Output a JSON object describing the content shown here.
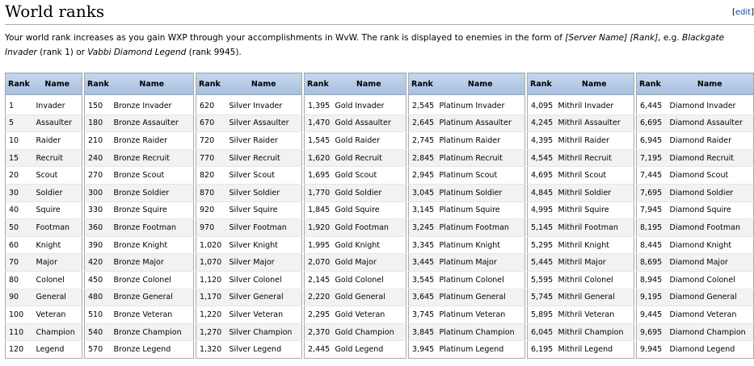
{
  "section": {
    "title": "World ranks",
    "edit_label": "edit"
  },
  "intro": {
    "part1": "Your world rank increases as you gain WXP through your accomplishments in WvW. The rank is displayed to enemies in the form of ",
    "format_italic": "[Server Name] [Rank]",
    "part2": ", e.g. ",
    "example1": "Blackgate Invader",
    "part3": " (rank 1) or ",
    "example2": "Vabbi Diamond Legend",
    "part4": " (rank 9945)."
  },
  "rank_tables": [
    {
      "headers": [
        "Rank",
        "Name"
      ],
      "rows": [
        [
          "1",
          "Invader"
        ],
        [
          "5",
          "Assaulter"
        ],
        [
          "10",
          "Raider"
        ],
        [
          "15",
          "Recruit"
        ],
        [
          "20",
          "Scout"
        ],
        [
          "30",
          "Soldier"
        ],
        [
          "40",
          "Squire"
        ],
        [
          "50",
          "Footman"
        ],
        [
          "60",
          "Knight"
        ],
        [
          "70",
          "Major"
        ],
        [
          "80",
          "Colonel"
        ],
        [
          "90",
          "General"
        ],
        [
          "100",
          "Veteran"
        ],
        [
          "110",
          "Champion"
        ],
        [
          "120",
          "Legend"
        ]
      ]
    },
    {
      "headers": [
        "Rank",
        "Name"
      ],
      "rows": [
        [
          "150",
          "Bronze Invader"
        ],
        [
          "180",
          "Bronze Assaulter"
        ],
        [
          "210",
          "Bronze Raider"
        ],
        [
          "240",
          "Bronze Recruit"
        ],
        [
          "270",
          "Bronze Scout"
        ],
        [
          "300",
          "Bronze Soldier"
        ],
        [
          "330",
          "Bronze Squire"
        ],
        [
          "360",
          "Bronze Footman"
        ],
        [
          "390",
          "Bronze Knight"
        ],
        [
          "420",
          "Bronze Major"
        ],
        [
          "450",
          "Bronze Colonel"
        ],
        [
          "480",
          "Bronze General"
        ],
        [
          "510",
          "Bronze Veteran"
        ],
        [
          "540",
          "Bronze Champion"
        ],
        [
          "570",
          "Bronze Legend"
        ]
      ]
    },
    {
      "headers": [
        "Rank",
        "Name"
      ],
      "rows": [
        [
          "620",
          "Silver Invader"
        ],
        [
          "670",
          "Silver Assaulter"
        ],
        [
          "720",
          "Silver Raider"
        ],
        [
          "770",
          "Silver Recruit"
        ],
        [
          "820",
          "Silver Scout"
        ],
        [
          "870",
          "Silver Soldier"
        ],
        [
          "920",
          "Silver Squire"
        ],
        [
          "970",
          "Silver Footman"
        ],
        [
          "1,020",
          "Silver Knight"
        ],
        [
          "1,070",
          "Silver Major"
        ],
        [
          "1,120",
          "Silver Colonel"
        ],
        [
          "1,170",
          "Silver General"
        ],
        [
          "1,220",
          "Silver Veteran"
        ],
        [
          "1,270",
          "Silver Champion"
        ],
        [
          "1,320",
          "Silver Legend"
        ]
      ]
    },
    {
      "headers": [
        "Rank",
        "Name"
      ],
      "rows": [
        [
          "1,395",
          "Gold Invader"
        ],
        [
          "1,470",
          "Gold Assaulter"
        ],
        [
          "1,545",
          "Gold Raider"
        ],
        [
          "1,620",
          "Gold Recruit"
        ],
        [
          "1,695",
          "Gold Scout"
        ],
        [
          "1,770",
          "Gold Soldier"
        ],
        [
          "1,845",
          "Gold Squire"
        ],
        [
          "1,920",
          "Gold Footman"
        ],
        [
          "1,995",
          "Gold Knight"
        ],
        [
          "2,070",
          "Gold Major"
        ],
        [
          "2,145",
          "Gold Colonel"
        ],
        [
          "2,220",
          "Gold General"
        ],
        [
          "2,295",
          "Gold Veteran"
        ],
        [
          "2,370",
          "Gold Champion"
        ],
        [
          "2,445",
          "Gold Legend"
        ]
      ]
    },
    {
      "headers": [
        "Rank",
        "Name"
      ],
      "rows": [
        [
          "2,545",
          "Platinum Invader"
        ],
        [
          "2,645",
          "Platinum Assaulter"
        ],
        [
          "2,745",
          "Platinum Raider"
        ],
        [
          "2,845",
          "Platinum Recruit"
        ],
        [
          "2,945",
          "Platinum Scout"
        ],
        [
          "3,045",
          "Platinum Soldier"
        ],
        [
          "3,145",
          "Platinum Squire"
        ],
        [
          "3,245",
          "Platinum Footman"
        ],
        [
          "3,345",
          "Platinum Knight"
        ],
        [
          "3,445",
          "Platinum Major"
        ],
        [
          "3,545",
          "Platinum Colonel"
        ],
        [
          "3,645",
          "Platinum General"
        ],
        [
          "3,745",
          "Platinum Veteran"
        ],
        [
          "3,845",
          "Platinum Champion"
        ],
        [
          "3,945",
          "Platinum Legend"
        ]
      ]
    },
    {
      "headers": [
        "Rank",
        "Name"
      ],
      "rows": [
        [
          "4,095",
          "Mithril Invader"
        ],
        [
          "4,245",
          "Mithril Assaulter"
        ],
        [
          "4,395",
          "Mithril Raider"
        ],
        [
          "4,545",
          "Mithril Recruit"
        ],
        [
          "4,695",
          "Mithril Scout"
        ],
        [
          "4,845",
          "Mithril Soldier"
        ],
        [
          "4,995",
          "Mithril Squire"
        ],
        [
          "5,145",
          "Mithril Footman"
        ],
        [
          "5,295",
          "Mithril Knight"
        ],
        [
          "5,445",
          "Mithril Major"
        ],
        [
          "5,595",
          "Mithril Colonel"
        ],
        [
          "5,745",
          "Mithril General"
        ],
        [
          "5,895",
          "Mithril Veteran"
        ],
        [
          "6,045",
          "Mithril Champion"
        ],
        [
          "6,195",
          "Mithril Legend"
        ]
      ]
    },
    {
      "headers": [
        "Rank",
        "Name"
      ],
      "rows": [
        [
          "6,445",
          "Diamond Invader"
        ],
        [
          "6,695",
          "Diamond Assaulter"
        ],
        [
          "6,945",
          "Diamond Raider"
        ],
        [
          "7,195",
          "Diamond Recruit"
        ],
        [
          "7,445",
          "Diamond Scout"
        ],
        [
          "7,695",
          "Diamond Soldier"
        ],
        [
          "7,945",
          "Diamond Squire"
        ],
        [
          "8,195",
          "Diamond Footman"
        ],
        [
          "8,445",
          "Diamond Knight"
        ],
        [
          "8,695",
          "Diamond Major"
        ],
        [
          "8,945",
          "Diamond Colonel"
        ],
        [
          "9,195",
          "Diamond General"
        ],
        [
          "9,445",
          "Diamond Veteran"
        ],
        [
          "9,695",
          "Diamond Champion"
        ],
        [
          "9,945",
          "Diamond Legend"
        ]
      ]
    }
  ]
}
